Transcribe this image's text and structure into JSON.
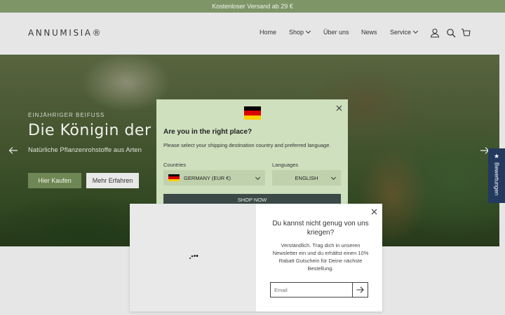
{
  "announcement": {
    "text": "Kostenloser Versand ab 29 €"
  },
  "header": {
    "logo": "ANNUMISIA®",
    "nav": [
      {
        "label": "Home"
      },
      {
        "label": "Shop",
        "dropdown": true
      },
      {
        "label": "Über uns"
      },
      {
        "label": "News"
      },
      {
        "label": "Service",
        "dropdown": true
      }
    ],
    "icons": [
      "account-icon",
      "search-icon",
      "cart-icon"
    ]
  },
  "hero": {
    "eyebrow": "EINJÄHRIGER BEIFUSS",
    "title": "Die Königin der P",
    "subtitle": "Natürliche Pflanzenrohstoffe aus Arten",
    "primary_button": "Hier Kaufen",
    "secondary_button": "Mehr Erfahren"
  },
  "reviews_tab": {
    "label": "Bewertungen"
  },
  "country_modal": {
    "title": "Are you in the right place?",
    "description": "Please select your shipping destination country and preferred language.",
    "countries_label": "Countries",
    "country_value": "GERMANY (EUR €)",
    "languages_label": "Languages",
    "language_value": "ENGLISH",
    "shop_button": "SHOP NOW",
    "flag_colors": [
      "#000000",
      "#dd0000",
      "#ffce00"
    ]
  },
  "newsletter_modal": {
    "title": "Du kannst nicht genug von uns kriegen?",
    "body": "Verständlich. Trag dich in unseren Newsletter ein und du erhältst einen 10% Rabatt Gutschein für Deine nächste Bestellung.",
    "email_placeholder": "Email"
  },
  "colors": {
    "brand_green": "#7e9568",
    "button_green": "#6f8754",
    "modal_green": "#cfe0bf",
    "reviews_blue": "#233a5e"
  }
}
